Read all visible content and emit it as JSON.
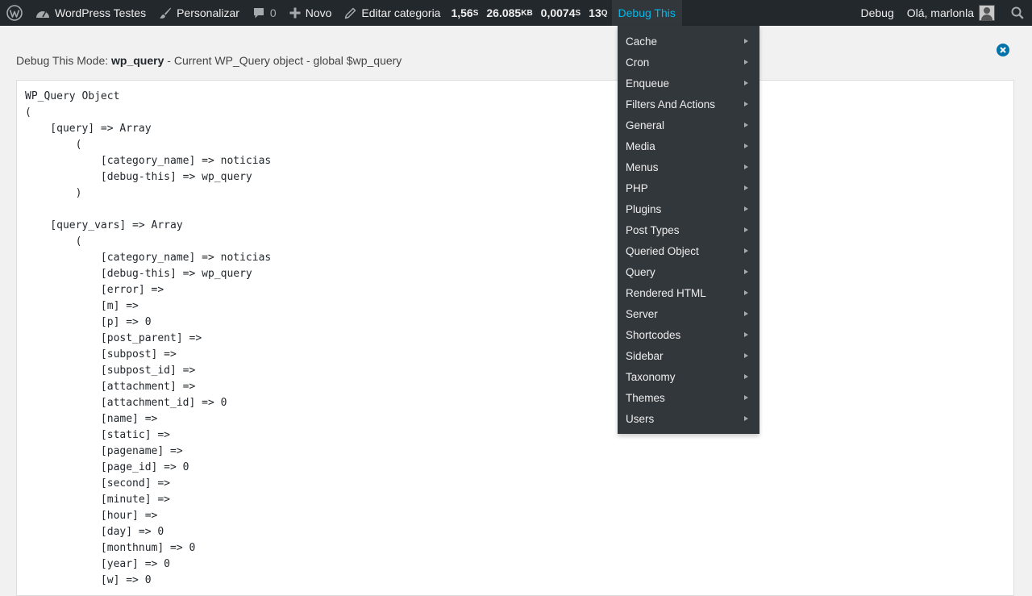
{
  "adminbar": {
    "wp_logo_icon": "wordpress-logo-icon",
    "site_name": "WordPress Testes",
    "customize_label": "Personalizar",
    "comments_count": "0",
    "new_label": "Novo",
    "edit_label": "Editar categoria",
    "stats": {
      "time": "1,56",
      "time_unit": "S",
      "memory": "26.085",
      "memory_unit": "KB",
      "query_time": "0,0074",
      "query_time_unit": "S",
      "queries": "13",
      "queries_unit": "Q"
    },
    "debug_this_label": "Debug This",
    "debug_label": "Debug",
    "greeting": "Olá, marlonla"
  },
  "page": {
    "mode_prefix": "Debug This Mode: ",
    "mode_name": "wp_query",
    "mode_desc": " - Current WP_Query object - global $wp_query",
    "dump_lines": [
      "WP_Query Object",
      "(",
      "    [query] => Array",
      "        (",
      "            [category_name] => noticias",
      "            [debug-this] => wp_query",
      "        )",
      "",
      "    [query_vars] => Array",
      "        (",
      "            [category_name] => noticias",
      "            [debug-this] => wp_query",
      "            [error] =>",
      "            [m] =>",
      "            [p] => 0",
      "            [post_parent] =>",
      "            [subpost] =>",
      "            [subpost_id] =>",
      "            [attachment] =>",
      "            [attachment_id] => 0",
      "            [name] =>",
      "            [static] =>",
      "            [pagename] =>",
      "            [page_id] => 0",
      "            [second] =>",
      "            [minute] =>",
      "            [hour] =>",
      "            [day] => 0",
      "            [monthnum] => 0",
      "            [year] => 0",
      "            [w] => 0"
    ]
  },
  "menu": {
    "items": [
      {
        "label": "Cache"
      },
      {
        "label": "Cron"
      },
      {
        "label": "Enqueue"
      },
      {
        "label": "Filters And Actions"
      },
      {
        "label": "General"
      },
      {
        "label": "Media"
      },
      {
        "label": "Menus"
      },
      {
        "label": "PHP"
      },
      {
        "label": "Plugins"
      },
      {
        "label": "Post Types"
      },
      {
        "label": "Queried Object"
      },
      {
        "label": "Query"
      },
      {
        "label": "Rendered HTML"
      },
      {
        "label": "Server"
      },
      {
        "label": "Shortcodes"
      },
      {
        "label": "Sidebar"
      },
      {
        "label": "Taxonomy"
      },
      {
        "label": "Themes"
      },
      {
        "label": "Users"
      }
    ]
  },
  "colors": {
    "adminbar_bg": "#23282d",
    "menu_bg": "#32373c",
    "accent": "#00b9eb",
    "close_button": "#0073aa"
  }
}
